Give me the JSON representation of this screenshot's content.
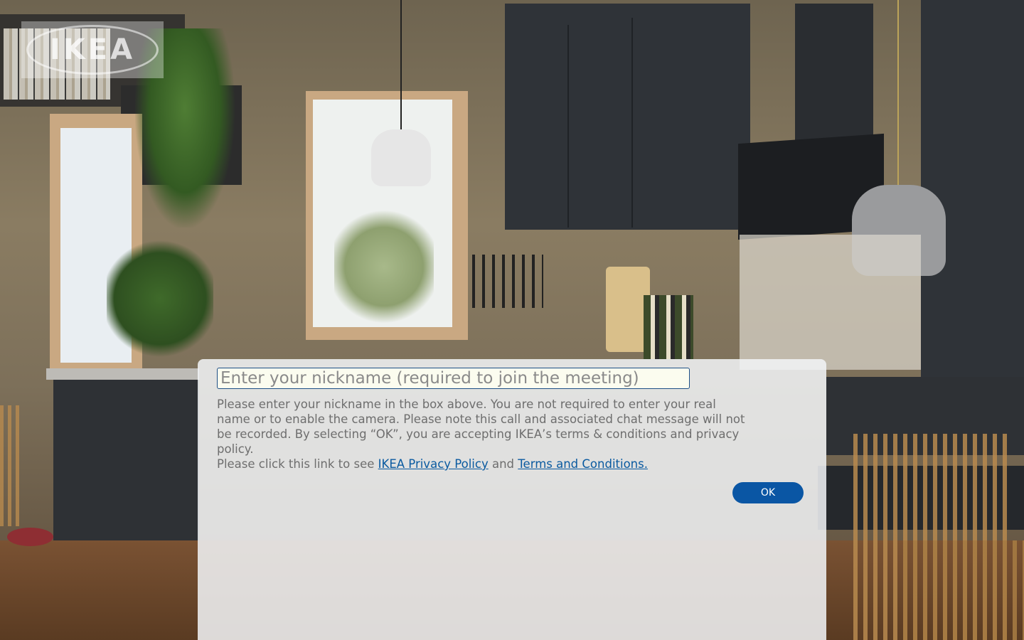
{
  "logo": {
    "text": "IKEA"
  },
  "dialog": {
    "nickname_placeholder": "Enter your nickname (required to join the meeting)",
    "nickname_value": "",
    "info_text": "Please enter your nickname in the box above. You are not required to enter your real name or to enable the camera. Please note this call and associated chat message will not be recorded. By selecting “OK”, you are accepting IKEA’s terms & conditions and privacy policy.",
    "link_prefix": "Please click this link to see ",
    "privacy_link": "IKEA Privacy Policy",
    "link_joiner": " and ",
    "terms_link": "Terms and Conditions.",
    "ok_label": "OK"
  },
  "colors": {
    "primary_button": "#0a56a4",
    "link": "#0a5aa0",
    "input_border": "#1d4f86"
  }
}
